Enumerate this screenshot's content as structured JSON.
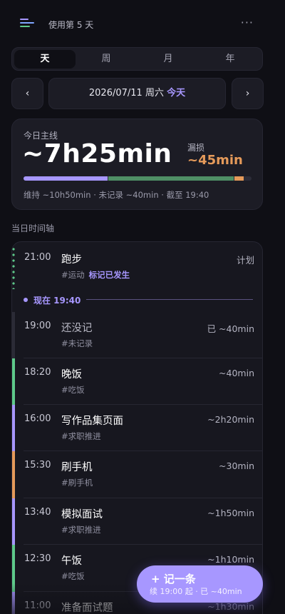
{
  "header": {
    "days_label": "使用第 5 天",
    "more_icon": "more-icon"
  },
  "period_tabs": [
    {
      "label": "天",
      "active": true
    },
    {
      "label": "周",
      "active": false
    },
    {
      "label": "月",
      "active": false
    },
    {
      "label": "年",
      "active": false
    }
  ],
  "date_nav": {
    "prev": "‹",
    "next": "›",
    "date": "2026/07/11 周六",
    "today": "今天"
  },
  "summary": {
    "label": "今日主线",
    "duration": "~7h25min",
    "loss_label": "漏损",
    "loss_value": "~45min",
    "meta": "维持 ~10h50min · 未记录 ~40min · 截至 19:40",
    "bar_segments": [
      {
        "name": "维持",
        "fraction": 0.37,
        "color": "#a797ff"
      },
      {
        "name": "主线",
        "fraction": 0.55,
        "color": "#4f8f65"
      },
      {
        "name": "漏损",
        "fraction": 0.04,
        "color": "#e59a5a"
      }
    ]
  },
  "timeline": {
    "title": "当日时间轴",
    "now": "现在 19:40",
    "entries": [
      {
        "time": "21:00",
        "title": "跑步",
        "tag": "#运动",
        "flag": "标记已发生",
        "dur": "计划",
        "color": "#5ec98a",
        "planned": true
      },
      {
        "time": "19:00",
        "title": "还没记",
        "tag": "#未记录",
        "flag": "",
        "dur": "已 ~40min",
        "color": "#2b2b36"
      },
      {
        "time": "18:20",
        "title": "晚饭",
        "tag": "#吃饭",
        "flag": "",
        "dur": "~40min",
        "color": "#5ec98a"
      },
      {
        "time": "16:00",
        "title": "写作品集页面",
        "tag": "#求职推进",
        "flag": "",
        "dur": "~2h20min",
        "color": "#a797ff"
      },
      {
        "time": "15:30",
        "title": "刷手机",
        "tag": "#刷手机",
        "flag": "",
        "dur": "~30min",
        "color": "#e59a5a"
      },
      {
        "time": "13:40",
        "title": "模拟面试",
        "tag": "#求职推进",
        "flag": "",
        "dur": "~1h50min",
        "color": "#a797ff"
      },
      {
        "time": "12:30",
        "title": "午饭",
        "tag": "#吃饭",
        "flag": "",
        "dur": "~1h10min",
        "color": "#5ec98a"
      },
      {
        "time": "11:00",
        "title": "准备面试题",
        "tag": "",
        "flag": "",
        "dur": "~1h30min",
        "color": "#a797ff"
      }
    ]
  },
  "fab": {
    "title": "+ 记一条",
    "sub": "续 19:00 起 · 已 ~40min"
  }
}
